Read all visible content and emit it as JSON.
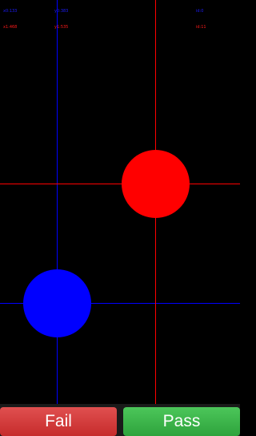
{
  "readouts": {
    "pointer_0": {
      "x": "x0:133",
      "y": "y0:383",
      "extra": "id:0"
    },
    "pointer_1": {
      "x": "x1:468",
      "y": "y1:535",
      "extra": "id:11"
    }
  },
  "touch_points": [
    {
      "name": "blue",
      "color": "#0000FF"
    },
    {
      "name": "red",
      "color": "#FF0000"
    }
  ],
  "buttons": {
    "fail_label": "Fail",
    "pass_label": "Pass"
  },
  "colors": {
    "background": "#000000",
    "blue": "#0000FF",
    "red": "#FF0000",
    "fail": "#D23B3B",
    "pass": "#3DB54A"
  }
}
